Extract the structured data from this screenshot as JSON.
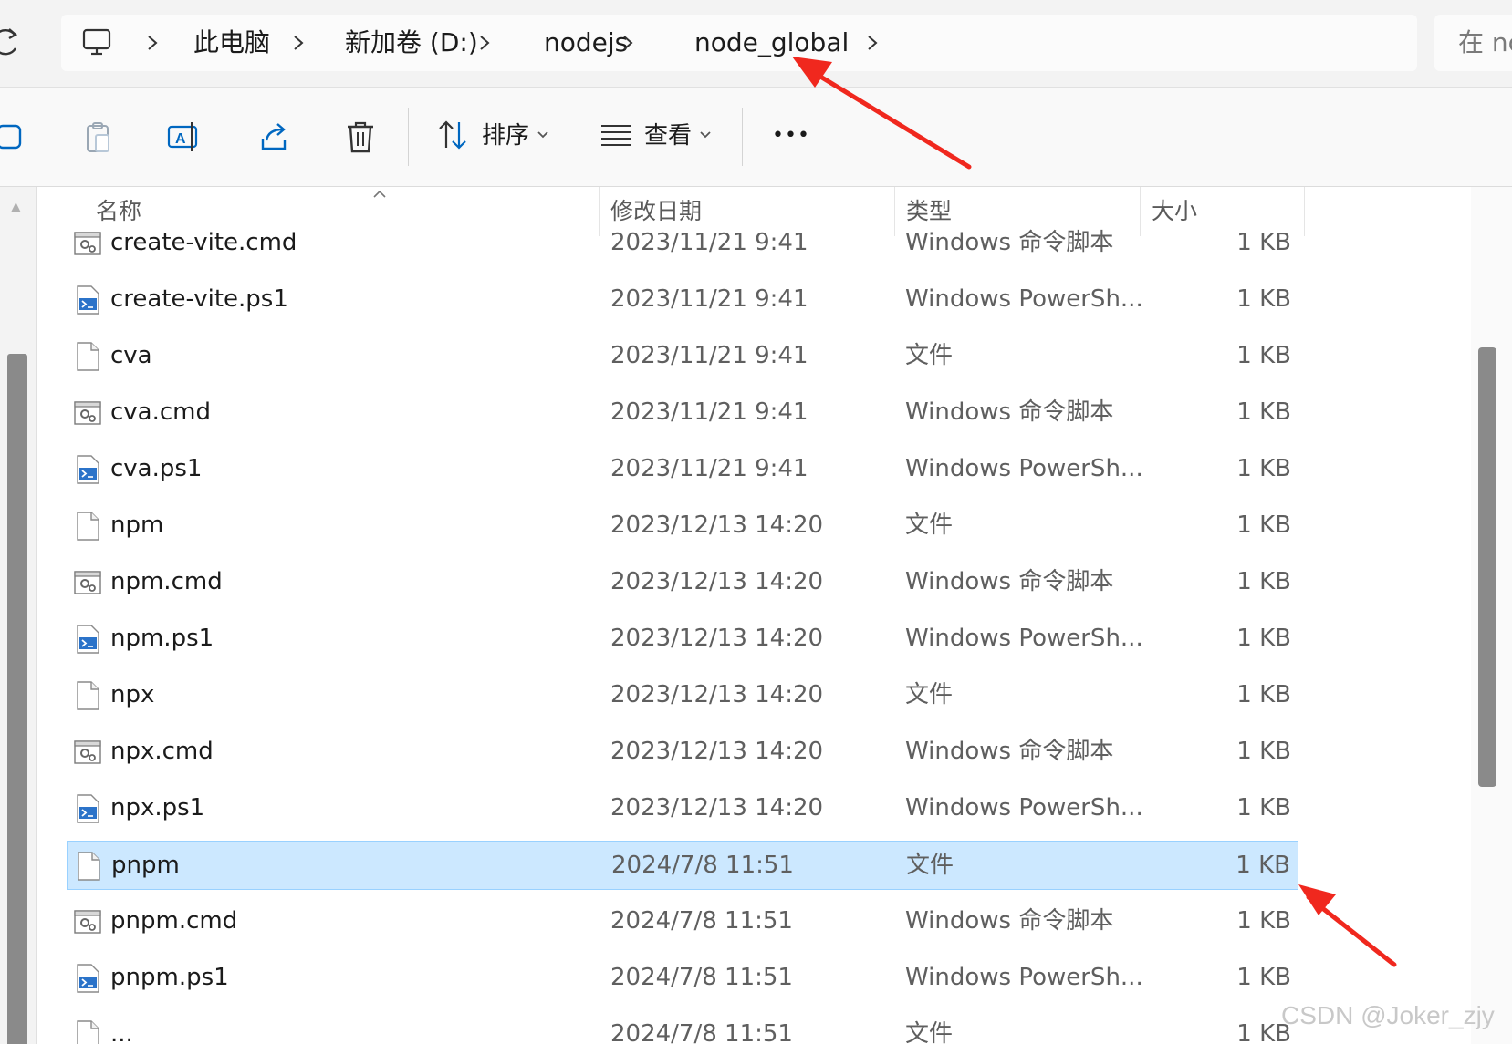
{
  "address": {
    "crumbs": [
      "此电脑",
      "新加卷 (D:)",
      "nodejs",
      "node_global"
    ],
    "search_placeholder": "在 nc"
  },
  "toolbar": {
    "sort_label": "排序",
    "view_label": "查看",
    "more_label": "•••"
  },
  "columns": {
    "name": "名称",
    "date": "修改日期",
    "type": "类型",
    "size": "大小"
  },
  "files": [
    {
      "name": "create-vite.cmd",
      "date": "2023/11/21 9:41",
      "type": "Windows 命令脚本",
      "size": "1 KB",
      "icon": "cmd-file-icon"
    },
    {
      "name": "create-vite.ps1",
      "date": "2023/11/21 9:41",
      "type": "Windows PowerSh...",
      "size": "1 KB",
      "icon": "powershell-file-icon"
    },
    {
      "name": "cva",
      "date": "2023/11/21 9:41",
      "type": "文件",
      "size": "1 KB",
      "icon": "blank-file-icon"
    },
    {
      "name": "cva.cmd",
      "date": "2023/11/21 9:41",
      "type": "Windows 命令脚本",
      "size": "1 KB",
      "icon": "cmd-file-icon"
    },
    {
      "name": "cva.ps1",
      "date": "2023/11/21 9:41",
      "type": "Windows PowerSh...",
      "size": "1 KB",
      "icon": "powershell-file-icon"
    },
    {
      "name": "npm",
      "date": "2023/12/13 14:20",
      "type": "文件",
      "size": "1 KB",
      "icon": "blank-file-icon"
    },
    {
      "name": "npm.cmd",
      "date": "2023/12/13 14:20",
      "type": "Windows 命令脚本",
      "size": "1 KB",
      "icon": "cmd-file-icon"
    },
    {
      "name": "npm.ps1",
      "date": "2023/12/13 14:20",
      "type": "Windows PowerSh...",
      "size": "1 KB",
      "icon": "powershell-file-icon"
    },
    {
      "name": "npx",
      "date": "2023/12/13 14:20",
      "type": "文件",
      "size": "1 KB",
      "icon": "blank-file-icon"
    },
    {
      "name": "npx.cmd",
      "date": "2023/12/13 14:20",
      "type": "Windows 命令脚本",
      "size": "1 KB",
      "icon": "cmd-file-icon"
    },
    {
      "name": "npx.ps1",
      "date": "2023/12/13 14:20",
      "type": "Windows PowerSh...",
      "size": "1 KB",
      "icon": "powershell-file-icon"
    },
    {
      "name": "pnpm",
      "date": "2024/7/8 11:51",
      "type": "文件",
      "size": "1 KB",
      "icon": "blank-file-icon",
      "selected": true
    },
    {
      "name": "pnpm.cmd",
      "date": "2024/7/8 11:51",
      "type": "Windows 命令脚本",
      "size": "1 KB",
      "icon": "cmd-file-icon"
    },
    {
      "name": "pnpm.ps1",
      "date": "2024/7/8 11:51",
      "type": "Windows PowerSh...",
      "size": "1 KB",
      "icon": "powershell-file-icon"
    },
    {
      "name": "...",
      "date": "2024/7/8 11:51",
      "type": "文件",
      "size": "1 KB",
      "icon": "blank-file-icon"
    }
  ],
  "colors": {
    "selection": "#cce8ff",
    "annotation_arrow": "#f0281e"
  },
  "watermark": "CSDN @Joker_zjy"
}
